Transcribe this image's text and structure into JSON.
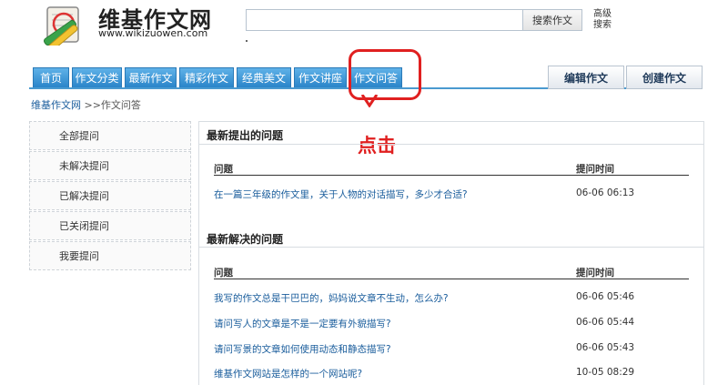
{
  "header": {
    "site_name": "维基作文网",
    "site_url": "www.wikizuowen.com",
    "search_placeholder": "",
    "search_button": "搜索作文",
    "advanced_search": "高级搜索"
  },
  "nav": {
    "tabs": [
      "首页",
      "作文分类",
      "最新作文",
      "精彩作文",
      "经典美文",
      "作文讲座",
      "作文问答"
    ],
    "edit_button": "编辑作文",
    "create_button": "创建作文"
  },
  "annotation": {
    "click_label": "点击",
    "color": "#e02020"
  },
  "breadcrumb": {
    "home": "维基作文网",
    "current": " >>作文问答"
  },
  "sidebar": {
    "items": [
      "全部提问",
      "未解决提问",
      "已解决提问",
      "已关闭提问",
      "我要提问"
    ]
  },
  "latest_asked": {
    "title": "最新提出的问题",
    "col_question": "问题",
    "col_time": "提问时间",
    "rows": [
      {
        "q": "在一篇三年级的作文里，关于人物的对话描写，多少才合适?",
        "t": "06-06 06:13"
      }
    ]
  },
  "latest_solved": {
    "title": "最新解决的问题",
    "col_question": "问题",
    "col_time": "提问时间",
    "rows": [
      {
        "q": "我写的作文总是干巴巴的，妈妈说文章不生动，怎么办?",
        "t": "06-06 05:46"
      },
      {
        "q": "请问写人的文章是不是一定要有外貌描写?",
        "t": "06-06 05:44"
      },
      {
        "q": "请问写景的文章如何使用动态和静态描写?",
        "t": "06-06 05:43"
      },
      {
        "q": "维基作文网站是怎样的一个网站呢?",
        "t": "10-05 08:29"
      }
    ]
  },
  "colors": {
    "nav_blue": "#2a85c9",
    "link_blue": "#1a5d9c",
    "accent_red": "#e02020"
  }
}
